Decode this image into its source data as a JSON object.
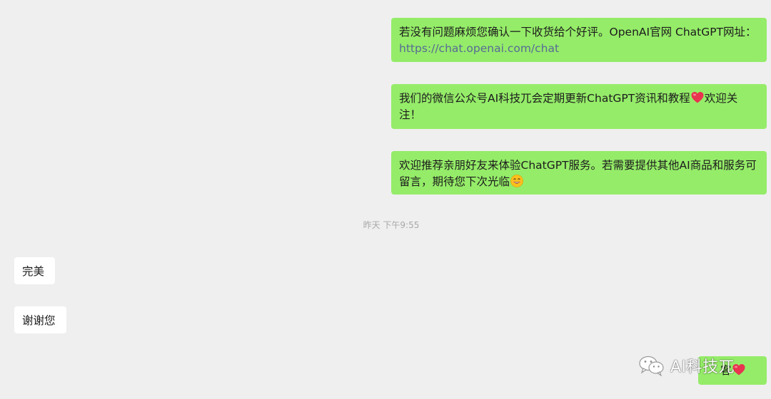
{
  "messages": {
    "m1": {
      "text_before_link": "若没有问题麻烦您确认一下收货给个好评。OpenAI官网 ChatGPT网址：",
      "link_text": "https://chat.openai.com/chat"
    },
    "m2": {
      "text_before_emoji": "我们的微信公众号AI科技兀会定期更新ChatGPT资讯和教程",
      "text_after_emoji": "欢迎关注！",
      "emoji": "heart-emoji"
    },
    "m3": {
      "text_before_emoji": "欢迎推荐亲朋好友来体验ChatGPT服务。若需要提供其他AI商品和服务可留言，期待您下次光临",
      "emoji": "smiling-face-emoji"
    },
    "timestamp": "昨天 下午9:55",
    "m4": {
      "text": "完美"
    },
    "m5": {
      "text": "谢谢您"
    },
    "m6": {
      "text": "客",
      "emoji": "heart-emoji"
    }
  },
  "watermark": {
    "text": "AI科技兀",
    "icon": "wechat-icon"
  },
  "colors": {
    "background": "#efefef",
    "outgoing_bubble": "#95ec69",
    "incoming_bubble": "#ffffff",
    "link": "#576b95",
    "timestamp": "#a8a8a8"
  }
}
